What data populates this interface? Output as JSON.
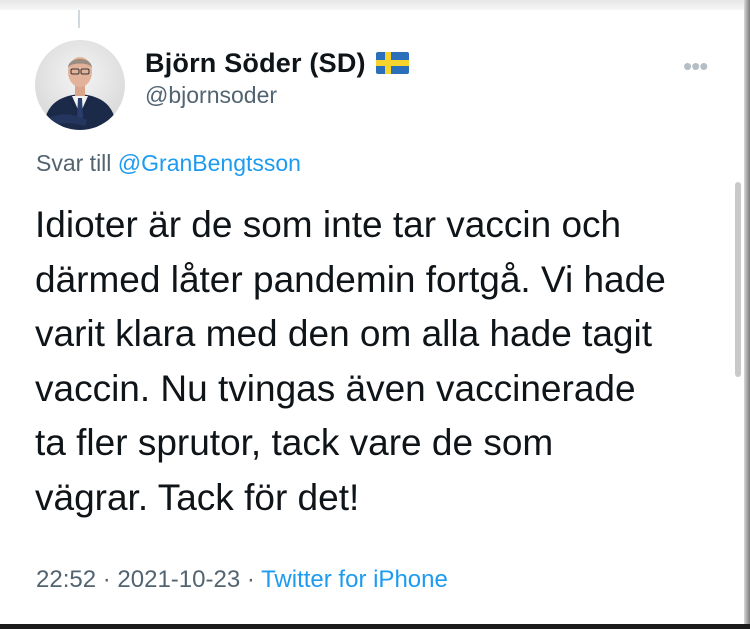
{
  "tweet": {
    "author": {
      "display_name": "Björn Söder (SD)",
      "handle": "@bjornsoder",
      "flag_icon": "sweden-flag-icon"
    },
    "more_icon": "more-options-icon",
    "reply_prefix": "Svar till",
    "reply_to": "@GranBengtsson",
    "text": "Idioter är de som inte tar vaccin och\ndärmed låter pandemin fortgå. Vi hade\nvarit klara med den om alla hade tagit\nvaccin. Nu tvingas även vaccinerade\nta fler sprutor, tack vare de som\nvägrar. Tack för det!",
    "time": "22:52",
    "separator": "·",
    "date": "2021-10-23",
    "source": "Twitter for iPhone"
  },
  "colors": {
    "text": "#0f1419",
    "secondary": "#536471",
    "link": "#1d9bf0"
  }
}
